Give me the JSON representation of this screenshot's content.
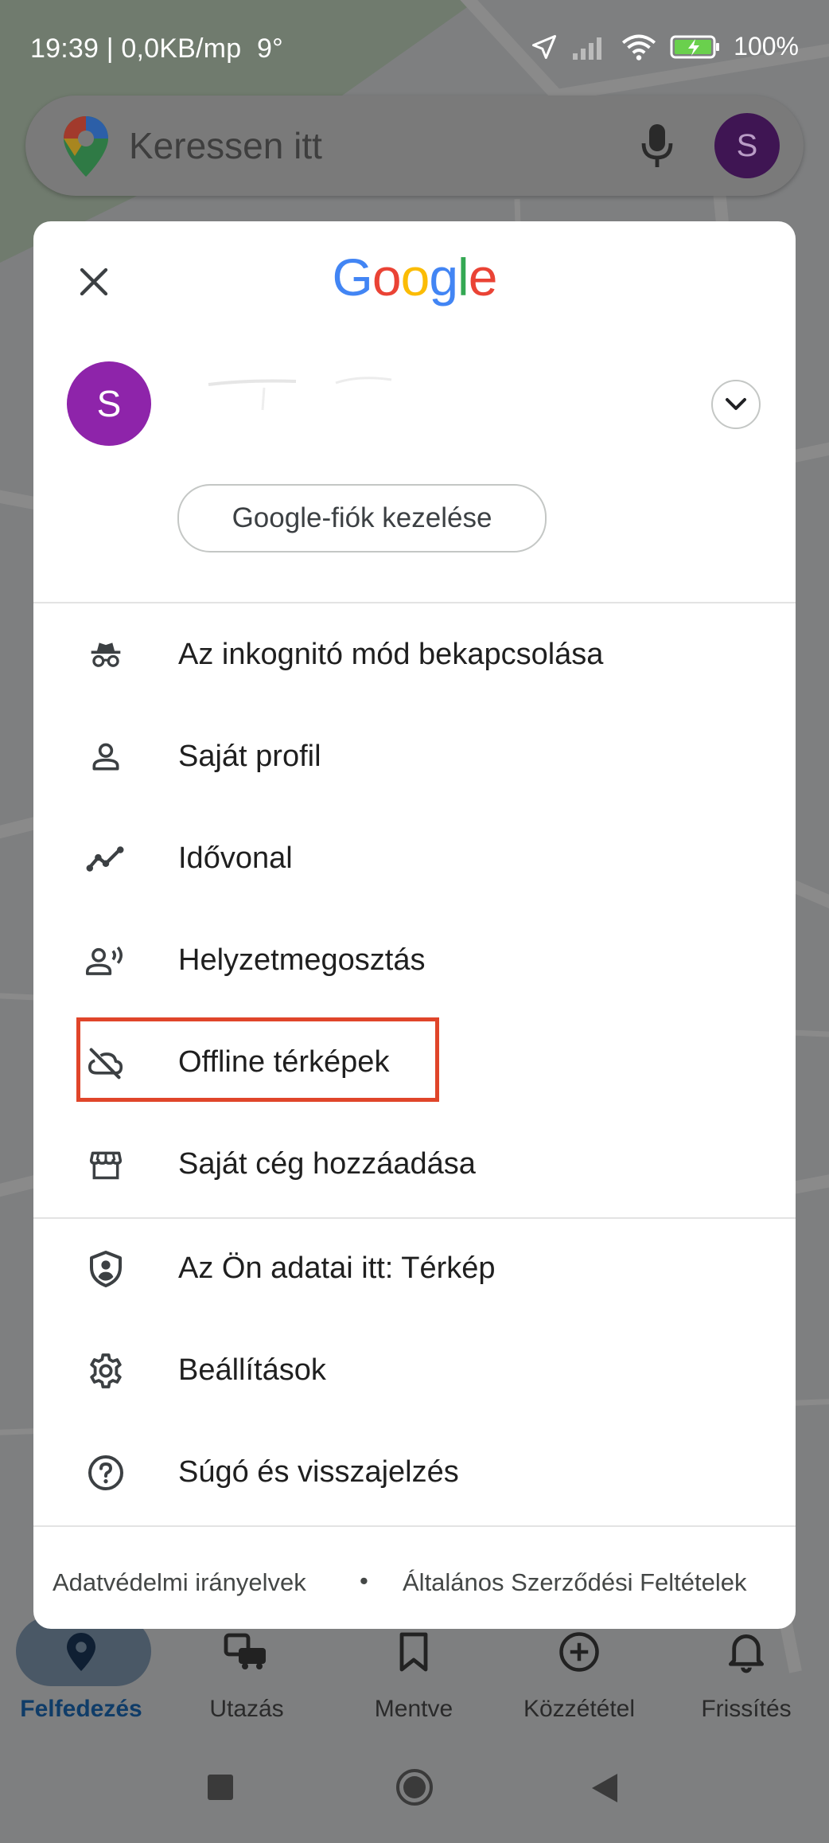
{
  "status_bar": {
    "time_info": "19:39 | 0,0KB/mp",
    "temperature": "9°",
    "battery": "100%",
    "icons": [
      "location-arrow-icon",
      "signal-icon",
      "wifi-icon",
      "battery-charging-icon"
    ]
  },
  "search": {
    "placeholder": "Keressen itt",
    "avatar_letter": "S"
  },
  "account_menu": {
    "logo_letters": [
      {
        "ch": "G",
        "color": "#4285F4"
      },
      {
        "ch": "o",
        "color": "#EA4335"
      },
      {
        "ch": "o",
        "color": "#FBBC05"
      },
      {
        "ch": "g",
        "color": "#4285F4"
      },
      {
        "ch": "l",
        "color": "#34A853"
      },
      {
        "ch": "e",
        "color": "#EA4335"
      }
    ],
    "avatar_letter": "S",
    "avatar_color": "#8E24AA",
    "manage_label": "Google-fiók kezelése",
    "items": [
      {
        "label": "Az inkognitó mód bekapcsolása",
        "icon": "incognito-icon"
      },
      {
        "label": "Saját profil",
        "icon": "person-icon"
      },
      {
        "label": "Idővonal",
        "icon": "timeline-icon"
      },
      {
        "label": "Helyzetmegosztás",
        "icon": "location-sharing-icon"
      },
      {
        "label": "Offline térképek",
        "icon": "cloud-off-icon",
        "highlighted": true
      },
      {
        "label": "Saját cég hozzáadása",
        "icon": "storefront-icon"
      },
      {
        "label": "Az Ön adatai itt: Térkép",
        "icon": "shield-person-icon"
      },
      {
        "label": "Beállítások",
        "icon": "gear-icon"
      },
      {
        "label": "Súgó és visszajelzés",
        "icon": "help-icon"
      }
    ],
    "footer": {
      "privacy": "Adatvédelmi irányelvek",
      "separator": "•",
      "terms": "Általános Szerződési Feltételek"
    },
    "highlight_color": "#E0452A"
  },
  "bottom_nav": {
    "items": [
      {
        "label": "Felfedezés",
        "icon": "location-pin-icon",
        "active": true
      },
      {
        "label": "Utazás",
        "icon": "commute-icon"
      },
      {
        "label": "Mentve",
        "icon": "bookmark-icon"
      },
      {
        "label": "Közzététel",
        "icon": "add-circle-icon"
      },
      {
        "label": "Frissítés",
        "icon": "bell-icon"
      }
    ]
  }
}
